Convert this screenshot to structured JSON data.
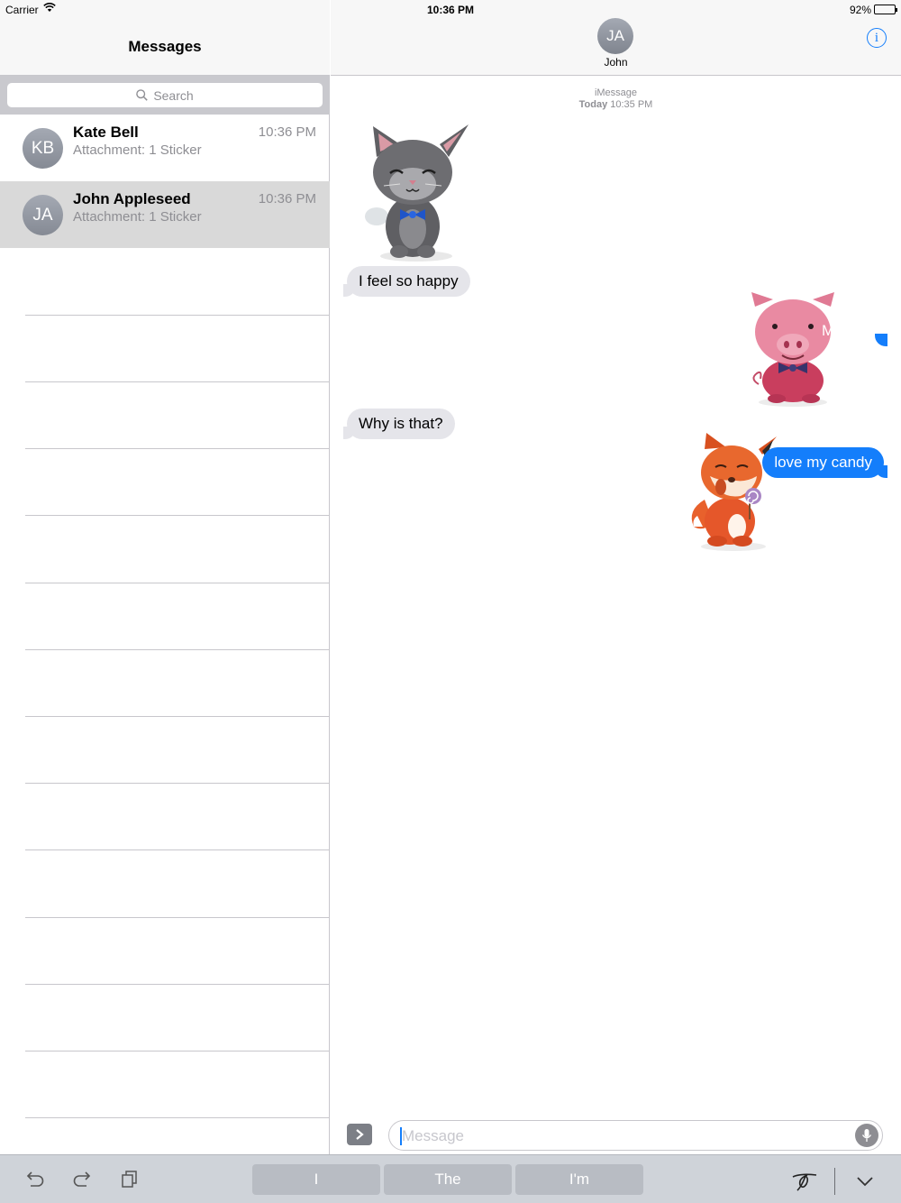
{
  "status_bar": {
    "carrier": "Carrier",
    "time": "10:36 PM",
    "battery": "92%",
    "battery_level": 0.92
  },
  "sidebar": {
    "title": "Messages",
    "search_placeholder": "Search",
    "conversations": [
      {
        "initials": "KB",
        "name": "Kate Bell",
        "preview": "Attachment: 1 Sticker",
        "time": "10:36 PM",
        "selected": false
      },
      {
        "initials": "JA",
        "name": "John Appleseed",
        "preview": "Attachment: 1 Sticker",
        "time": "10:36 PM",
        "selected": true
      }
    ]
  },
  "conversation": {
    "contact_initials": "JA",
    "contact_name": "John",
    "service": "iMessage",
    "date_label": "Today",
    "date_time": "10:35 PM",
    "messages": [
      {
        "direction": "in",
        "sticker": "cat-sticker",
        "text": "I feel so happy"
      },
      {
        "direction": "out",
        "sticker": "pig-sticker",
        "text": "Me too"
      },
      {
        "direction": "in",
        "text": "Why is that?"
      },
      {
        "direction": "out",
        "sticker": "fox-sticker",
        "text": "love my candy"
      }
    ],
    "compose_placeholder": "Message"
  },
  "keyboard_bar": {
    "suggestions": [
      "I",
      "The",
      "I'm"
    ]
  },
  "colors": {
    "accent": "#147efb",
    "incoming_bubble": "#e5e5ea",
    "selected_row": "#d9d9d9"
  }
}
